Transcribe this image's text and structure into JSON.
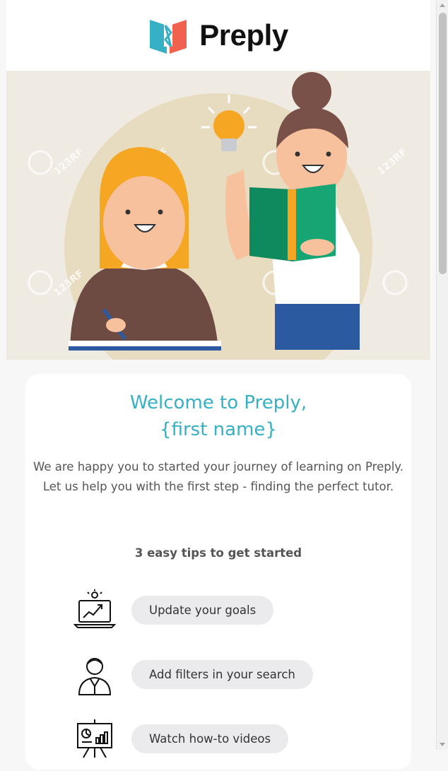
{
  "brand": {
    "name": "Preply",
    "colors": {
      "teal": "#35b0c4",
      "coral": "#f0614e"
    }
  },
  "hero": {
    "illustration": "student-and-teacher-with-books",
    "watermark": "123RF"
  },
  "welcome": {
    "line1": "Welcome to Preply,",
    "line2": "{first name}"
  },
  "intro": {
    "line1": "We are happy you to started your journey of learning on Preply.",
    "line2": "Let us help you with the first step - finding the perfect tutor."
  },
  "tips": {
    "heading": "3 easy tips to get started",
    "items": [
      {
        "icon": "laptop-growth-icon",
        "label": "Update your goals"
      },
      {
        "icon": "person-icon",
        "label": "Add filters in your search"
      },
      {
        "icon": "presentation-board-icon",
        "label": "Watch how-to videos"
      }
    ]
  }
}
